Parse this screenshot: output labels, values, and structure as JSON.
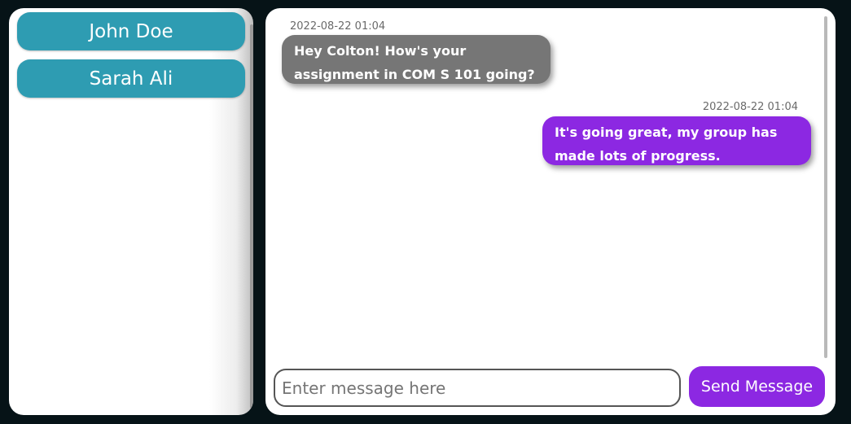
{
  "sidebar": {
    "contacts": [
      {
        "name": "John Doe"
      },
      {
        "name": "Sarah Ali"
      }
    ]
  },
  "chat": {
    "messages": [
      {
        "direction": "incoming",
        "timestamp": "2022-08-22 01:04",
        "text": "Hey Colton! How's your assignment in COM S 101 going?"
      },
      {
        "direction": "outgoing",
        "timestamp": "2022-08-22 01:04",
        "text": "It's going great, my group has made lots of progress."
      }
    ],
    "composer": {
      "placeholder": "Enter message here",
      "value": "",
      "send_label": "Send Message"
    }
  },
  "colors": {
    "background": "#061317",
    "contact_button": "#2e9cb2",
    "incoming_bubble": "#767676",
    "outgoing_bubble": "#8c28e2",
    "send_button": "#8c28e2"
  }
}
